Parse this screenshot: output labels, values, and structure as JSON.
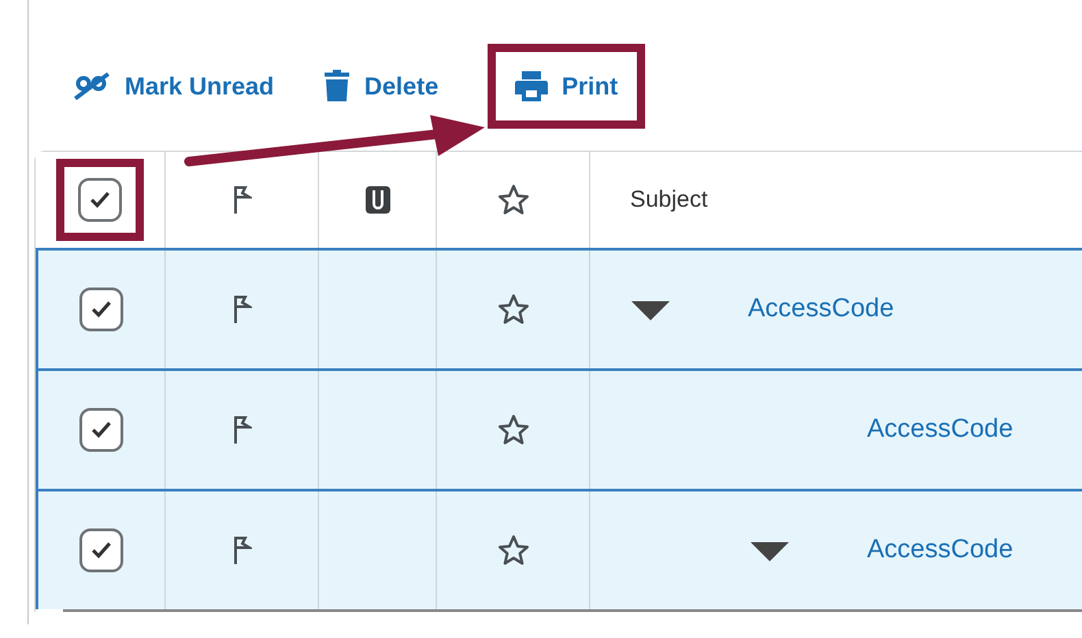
{
  "toolbar": [
    {
      "kind": "mark-unread",
      "label": "Mark Unread",
      "highlighted": false
    },
    {
      "kind": "delete",
      "label": "Delete",
      "highlighted": false
    },
    {
      "kind": "print",
      "label": "Print",
      "highlighted": true
    }
  ],
  "annotation_arrow": true,
  "table": {
    "header": {
      "checked": true,
      "highlighted": true,
      "subject_label": "Subject"
    },
    "rows": [
      {
        "checked": true,
        "subject": "AccessCode",
        "expanded": true,
        "children": [
          {
            "checked": true,
            "subject": "AccessCode"
          },
          {
            "checked": true,
            "subject": "AccessCode",
            "expanded": true
          }
        ]
      }
    ]
  }
}
